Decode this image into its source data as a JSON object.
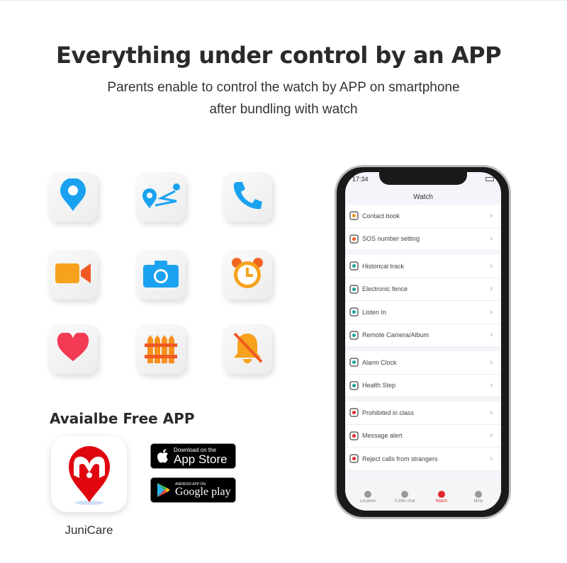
{
  "heading": "Everything under control by an APP",
  "subtitle_line1": "Parents enable to control the watch by APP on smartphone",
  "subtitle_line2": "after bundling with watch",
  "feature_icons": [
    "location-pin-icon",
    "route-icon",
    "phone-icon",
    "video-camera-icon",
    "camera-icon",
    "alarm-clock-icon",
    "heart-icon",
    "fence-icon",
    "bell-off-icon"
  ],
  "available": {
    "title": "Avaialbe Free APP",
    "app_name": "JuniCare",
    "appstore_small": "Download on the",
    "appstore_big": "App Store",
    "google_small": "ANDROID APP ON",
    "google_big": "Google play"
  },
  "phone": {
    "time": "17:34",
    "header": "Watch",
    "groups": [
      [
        {
          "label": "Contact book",
          "icon": "contact-book-icon"
        },
        {
          "label": "SOS number setting",
          "icon": "sos-alarm-icon"
        }
      ],
      [
        {
          "label": "Historical track",
          "icon": "track-icon"
        },
        {
          "label": "Electronic fence",
          "icon": "fence-pentagon-icon"
        },
        {
          "label": "Listen In",
          "icon": "headphones-icon"
        },
        {
          "label": "Remote Camera/Album",
          "icon": "camera-icon"
        }
      ],
      [
        {
          "label": "Alarm Clock",
          "icon": "alarm-clock-icon"
        },
        {
          "label": "Health Step",
          "icon": "shoe-icon"
        }
      ],
      [
        {
          "label": "Prohibited in class",
          "icon": "prohibited-class-icon"
        },
        {
          "label": "Message alert",
          "icon": "message-icon"
        },
        {
          "label": "Reject calls from strangers",
          "icon": "reject-call-icon"
        }
      ]
    ],
    "nav": [
      {
        "label": "Location",
        "active": false
      },
      {
        "label": "A little chat",
        "active": false
      },
      {
        "label": "Watch",
        "active": true
      },
      {
        "label": "Mine",
        "active": false
      }
    ],
    "accent": "#e0282e"
  }
}
